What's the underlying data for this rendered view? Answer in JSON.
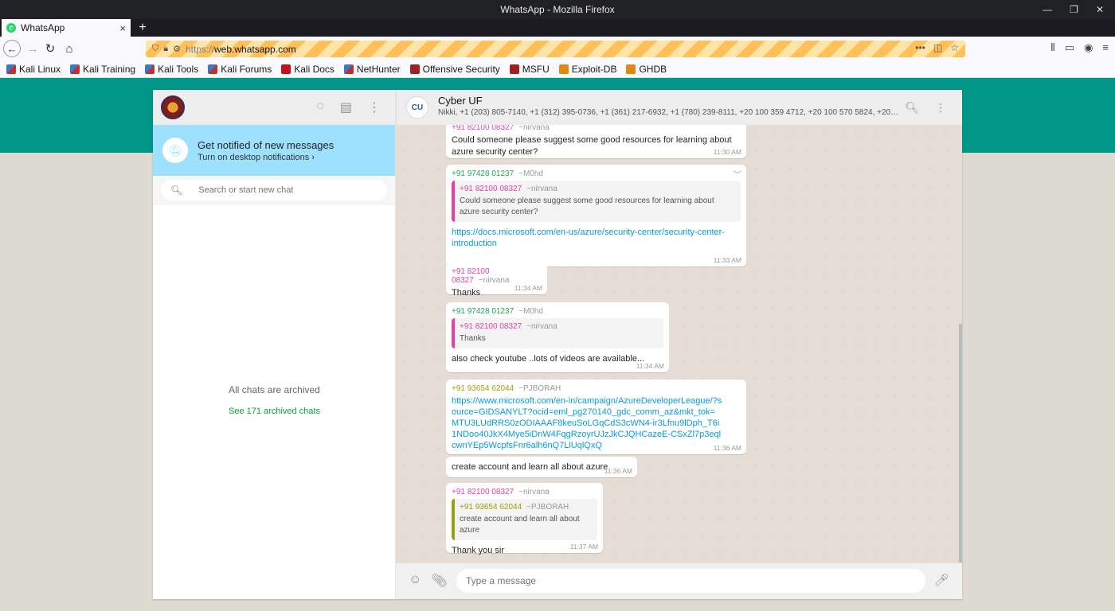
{
  "window": {
    "title": "WhatsApp - Mozilla Firefox"
  },
  "tab": {
    "title": "WhatsApp",
    "close": "×",
    "new": "+"
  },
  "url": {
    "protocol": "https://",
    "host": "web.whatsapp.com"
  },
  "bookmarks": [
    {
      "label": "Kali Linux",
      "icon": "kali-icon"
    },
    {
      "label": "Kali Training",
      "icon": "kali-icon"
    },
    {
      "label": "Kali Tools",
      "icon": "kali-icon"
    },
    {
      "label": "Kali Forums",
      "icon": "kali-icon"
    },
    {
      "label": "Kali Docs",
      "icon": "kali-docs-icon"
    },
    {
      "label": "NetHunter",
      "icon": "kali-icon"
    },
    {
      "label": "Offensive Security",
      "icon": "offsec-icon"
    },
    {
      "label": "MSFU",
      "icon": "offsec-icon"
    },
    {
      "label": "Exploit-DB",
      "icon": "exploitdb-icon"
    },
    {
      "label": "GHDB",
      "icon": "exploitdb-icon"
    }
  ],
  "sidebar": {
    "notif_title": "Get notified of new messages",
    "notif_sub": "Turn on desktop notifications ›",
    "search_placeholder": "Search or start new chat",
    "archived_text": "All chats are archived",
    "archived_link": "See 171 archived chats"
  },
  "chat": {
    "name": "Cyber UF",
    "avatar_text": "CU",
    "members": "Nikki, +1 (203) 805-7140, +1 (312) 395-0736, +1 (361) 217-6932, +1 (780) 239-8111, +20 100 359 4712, +20 100 570 5824, +20 100 ...",
    "compose_placeholder": "Type a message"
  },
  "messages": [
    {
      "sender": "+91 82100 08327",
      "alias": "~nirvana",
      "text": "Could someone please suggest some good resources for learning about azure security center?",
      "time": "11:30 AM"
    },
    {
      "sender": "+91 97428 01237",
      "alias": "~M0hd",
      "quote_sender": "+91 82100 08327",
      "quote_alias": "~nirvana",
      "quote_text": "Could someone please suggest some good resources for learning about azure security center?",
      "link": "https://docs.microsoft.com/en-us/azure/security-center/security-center-introduction",
      "time": "11:33 AM"
    },
    {
      "sender": "+91 82100 08327",
      "alias": "~nirvana",
      "text": "Thanks",
      "time": "11:34 AM"
    },
    {
      "sender": "+91 97428 01237",
      "alias": "~M0hd",
      "quote_sender": "+91 82100 08327",
      "quote_alias": "~nirvana",
      "quote_text": "Thanks",
      "text": "also check youtube ..lots of videos are available...",
      "time": "11:34 AM"
    },
    {
      "sender": "+91 93654 62044",
      "alias": "~PJBORAH",
      "link": "https://www.microsoft.com/en-in/campaign/AzureDeveloperLeague/?source=GIDSANYLT?ocid=eml_pg270140_gdc_comm_az&mkt_tok=MTU3LUdRRS0zODIAAAF8keuSoLGqCdS3cWN4-ir3Lfnu9lDph_T6i1NDoo40JkX4Mye5iDnW4FqgRzoyrUJzJkCJQHCazeE-CSxZl7p3eqlcwnYEp5WcpfsFnr6alh6nQ7LlUqlQxQ",
      "time": "11:36 AM"
    },
    {
      "text": "create account and learn  all about azure",
      "time": "11:36 AM"
    },
    {
      "sender": "+91 82100 08327",
      "alias": "~nirvana",
      "quote_sender": "+91 93654 62044",
      "quote_alias": "~PJBORAH",
      "quote_text": "create account and learn  all about azure",
      "text": "Thank you sir",
      "time": "11:37 AM"
    }
  ],
  "colors": {
    "teal": "#009688",
    "bubble": "#ffffff",
    "chat_bg": "#e5ddd5",
    "link": "#039be5",
    "notif": "#9de1fe"
  }
}
